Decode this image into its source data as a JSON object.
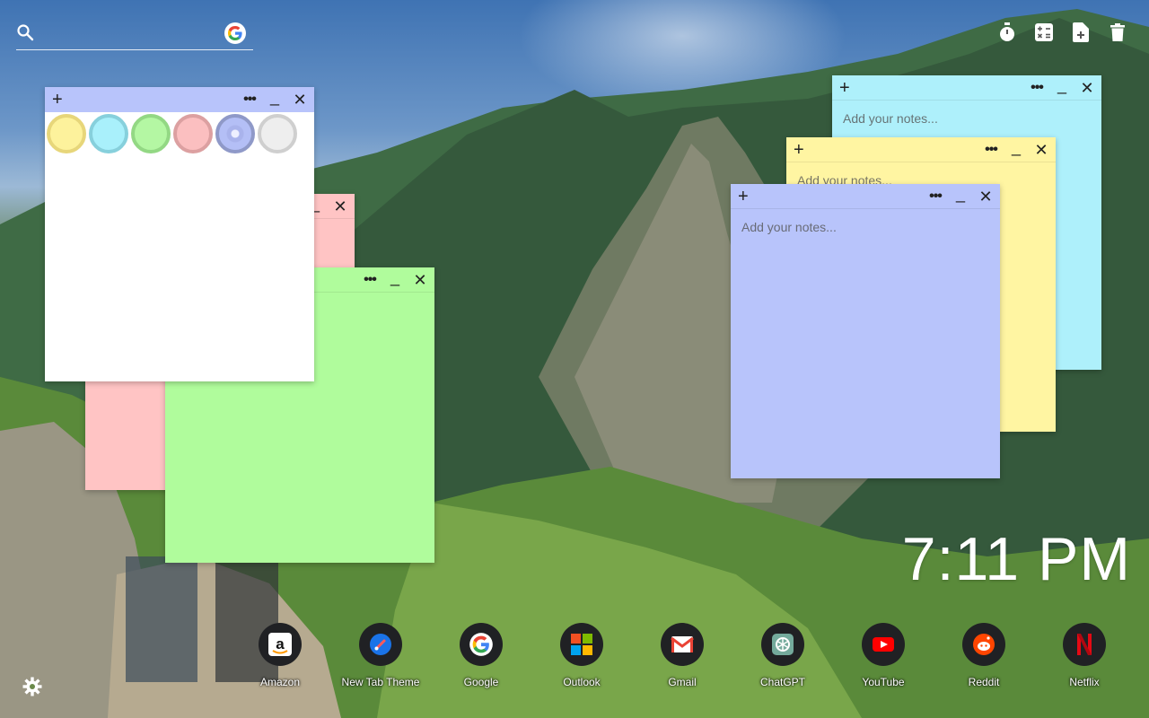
{
  "search": {
    "placeholder": ""
  },
  "tools": [
    {
      "icon": "stopwatch-icon"
    },
    {
      "icon": "calculator-icon"
    },
    {
      "icon": "new-note-icon"
    },
    {
      "icon": "trash-icon"
    }
  ],
  "notes": [
    {
      "color": "#aef0fb",
      "placeholder": "Add your notes..."
    },
    {
      "color": "#fff5a2",
      "placeholder": "Add your notes..."
    },
    {
      "color": "#b8c4fb",
      "placeholder": "Add your notes..."
    },
    {
      "color": "#ffc4c4",
      "placeholder": ""
    },
    {
      "color": "#b0fc9c",
      "placeholder": ""
    },
    {
      "color": "#ffffff",
      "placeholder": ""
    }
  ],
  "note_controls": {
    "add": "+",
    "menu": "•••",
    "minimize": "_",
    "close": "✕"
  },
  "color_picker": {
    "colors": [
      {
        "fill": "#fdf29c",
        "ring": "#e7d67a"
      },
      {
        "fill": "#a9f0fb",
        "ring": "#87d0dc"
      },
      {
        "fill": "#b4f7a3",
        "ring": "#93d884"
      },
      {
        "fill": "#fbbfc0",
        "ring": "#dca0a1"
      },
      {
        "fill": "#b4bff6",
        "ring": "#8f99c8"
      },
      {
        "fill": "#eeeeee",
        "ring": "#cfcfcf"
      }
    ],
    "selected_index": 4
  },
  "clock": {
    "time": "7:11 PM"
  },
  "shortcuts": [
    {
      "label": "Amazon",
      "icon": "amazon-icon"
    },
    {
      "label": "New Tab Theme",
      "icon": "new-tab-theme-icon"
    },
    {
      "label": "Google",
      "icon": "google-icon"
    },
    {
      "label": "Outlook",
      "icon": "outlook-icon"
    },
    {
      "label": "Gmail",
      "icon": "gmail-icon"
    },
    {
      "label": "ChatGPT",
      "icon": "chatgpt-icon"
    },
    {
      "label": "YouTube",
      "icon": "youtube-icon"
    },
    {
      "label": "Reddit",
      "icon": "reddit-icon"
    },
    {
      "label": "Netflix",
      "icon": "netflix-icon"
    }
  ]
}
